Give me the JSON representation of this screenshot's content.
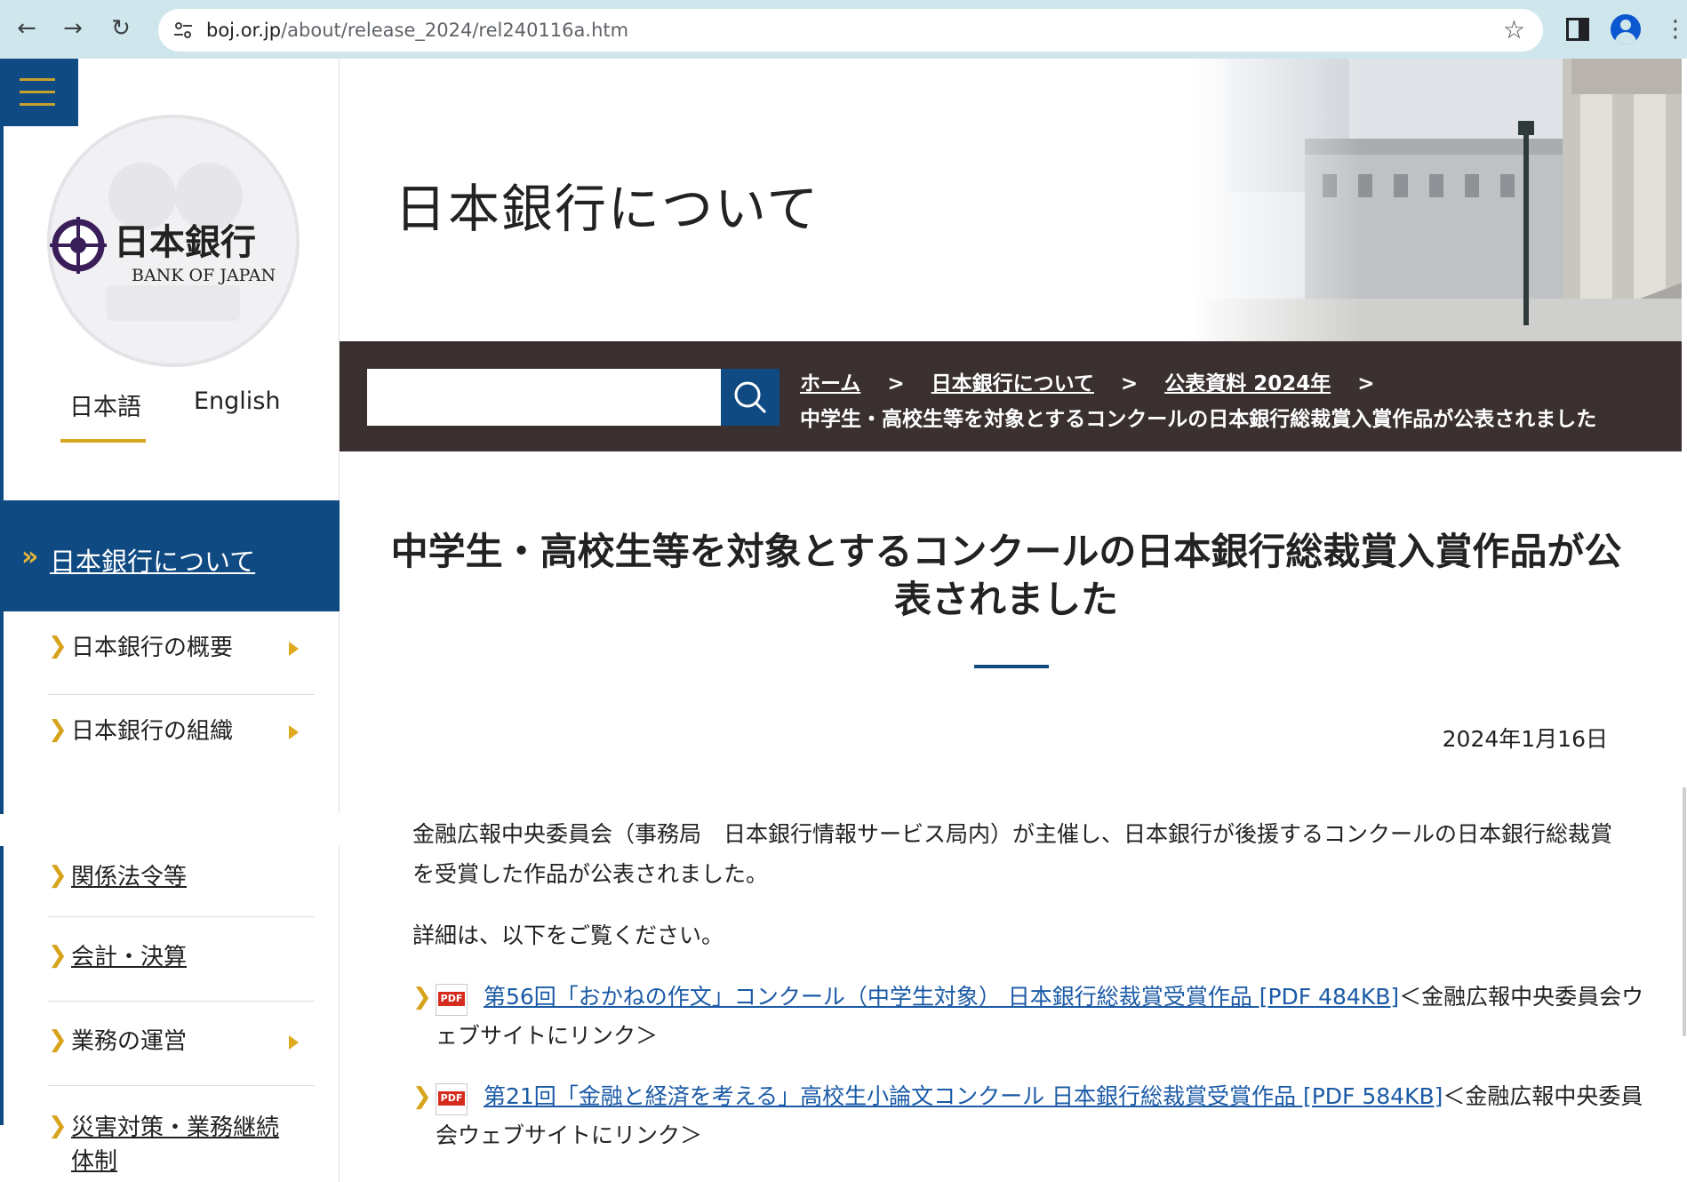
{
  "browser": {
    "url_host": "boj.or.jp",
    "url_path": "/about/release_2024/rel240116a.htm",
    "icons": {
      "back": "arrow-left-icon",
      "forward": "arrow-right-icon",
      "reload": "reload-icon",
      "site_info": "tune-icon",
      "bookmark": "star-icon",
      "side_panel": "side-panel-icon",
      "profile": "profile-icon",
      "menu": "kebab-menu-icon"
    }
  },
  "sidebar": {
    "menu_icon": "hamburger-icon",
    "logo": {
      "name_ja": "日本銀行",
      "name_en": "BANK OF JAPAN"
    },
    "languages": [
      "日本語",
      "English"
    ],
    "active_section": "日本銀行について",
    "items": [
      {
        "label": "日本銀行の概要",
        "has_submenu": true,
        "link": false
      },
      {
        "label": "日本銀行の組織",
        "has_submenu": true,
        "link": false
      },
      {
        "label": "関係法令等",
        "has_submenu": false,
        "link": true
      },
      {
        "label": "会計・決算",
        "has_submenu": false,
        "link": true
      },
      {
        "label": "業務の運営",
        "has_submenu": true,
        "link": false
      },
      {
        "label": "災害対策・業務継続体制",
        "has_submenu": false,
        "link": true
      }
    ]
  },
  "header": {
    "title": "日本銀行について"
  },
  "search": {
    "placeholder": "",
    "icon": "search-icon"
  },
  "breadcrumb": {
    "items": [
      "ホーム",
      "日本銀行について",
      "公表資料 2024年"
    ],
    "separator": ">",
    "current": "中学生・高校生等を対象とするコンクールの日本銀行総裁賞入賞作品が公表されました"
  },
  "article": {
    "title_line1": "中学生・高校生等を対象とするコンクールの日本銀行総裁賞入賞作品が公",
    "title_line2": "表されました",
    "date": "2024年1月16日",
    "paragraph1": "金融広報中央委員会（事務局　日本銀行情報サービス局内）が主催し、日本銀行が後援するコンクールの日本銀行総裁賞を受賞した作品が公表されました。",
    "paragraph2": "詳細は、以下をご覧ください。",
    "links": [
      {
        "link_text": "第56回「おかねの作文」コンクール（中学生対象） 日本銀行総裁賞受賞作品 [PDF 484KB]",
        "suffix": "＜金融広報中央委員会ウェブサイトにリンク＞",
        "badge": "PDF"
      },
      {
        "link_text": "第21回「金融と経済を考える」高校生小論文コンクール 日本銀行総裁賞受賞作品 [PDF 584KB]",
        "suffix": "＜金融広報中央委員会ウェブサイトにリンク＞",
        "badge": "PDF"
      }
    ]
  },
  "colors": {
    "primary_blue": "#0f4a83",
    "accent_gold": "#d9a61f",
    "bar_dark": "#3a3030",
    "link_blue": "#1a5aa6"
  }
}
